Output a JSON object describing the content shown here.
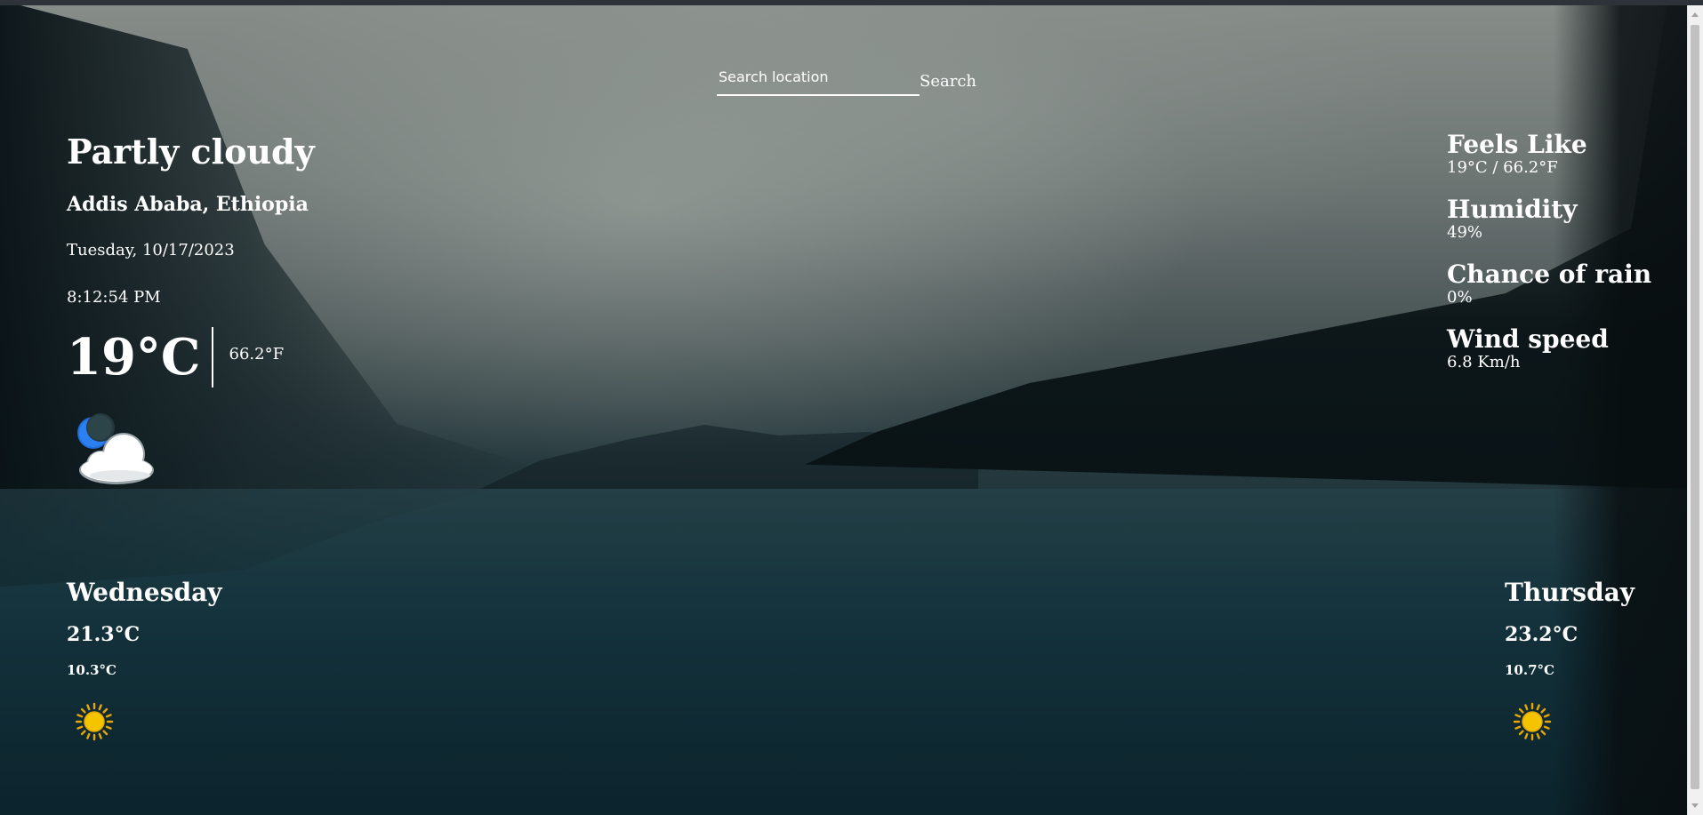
{
  "search": {
    "placeholder": "Search location",
    "button_label": "Search"
  },
  "current": {
    "condition": "Partly cloudy",
    "location": "Addis Ababa, Ethiopia",
    "date": "Tuesday, 10/17/2023",
    "time": "8:12:54 PM",
    "temp_c": "19°C",
    "temp_f": "66.2°F",
    "icon": "night-partly-cloudy-icon"
  },
  "details": {
    "feels_like": {
      "title": "Feels Like",
      "value": "19°C / 66.2°F"
    },
    "humidity": {
      "title": "Humidity",
      "value": "49%"
    },
    "chance_of_rain": {
      "title": "Chance of rain",
      "value": "0%"
    },
    "wind_speed": {
      "title": "Wind speed",
      "value": "6.8 Km/h"
    }
  },
  "forecast": [
    {
      "day": "Wednesday",
      "max": "21.3°C",
      "min": "10.3°C",
      "icon": "sun-icon"
    },
    {
      "day": "Thursday",
      "max": "23.2°C",
      "min": "10.7°C",
      "icon": "sun-icon"
    }
  ],
  "colors": {
    "text": "#ffffff",
    "moon": "#1e6fd9",
    "sun": "#f5c400"
  }
}
